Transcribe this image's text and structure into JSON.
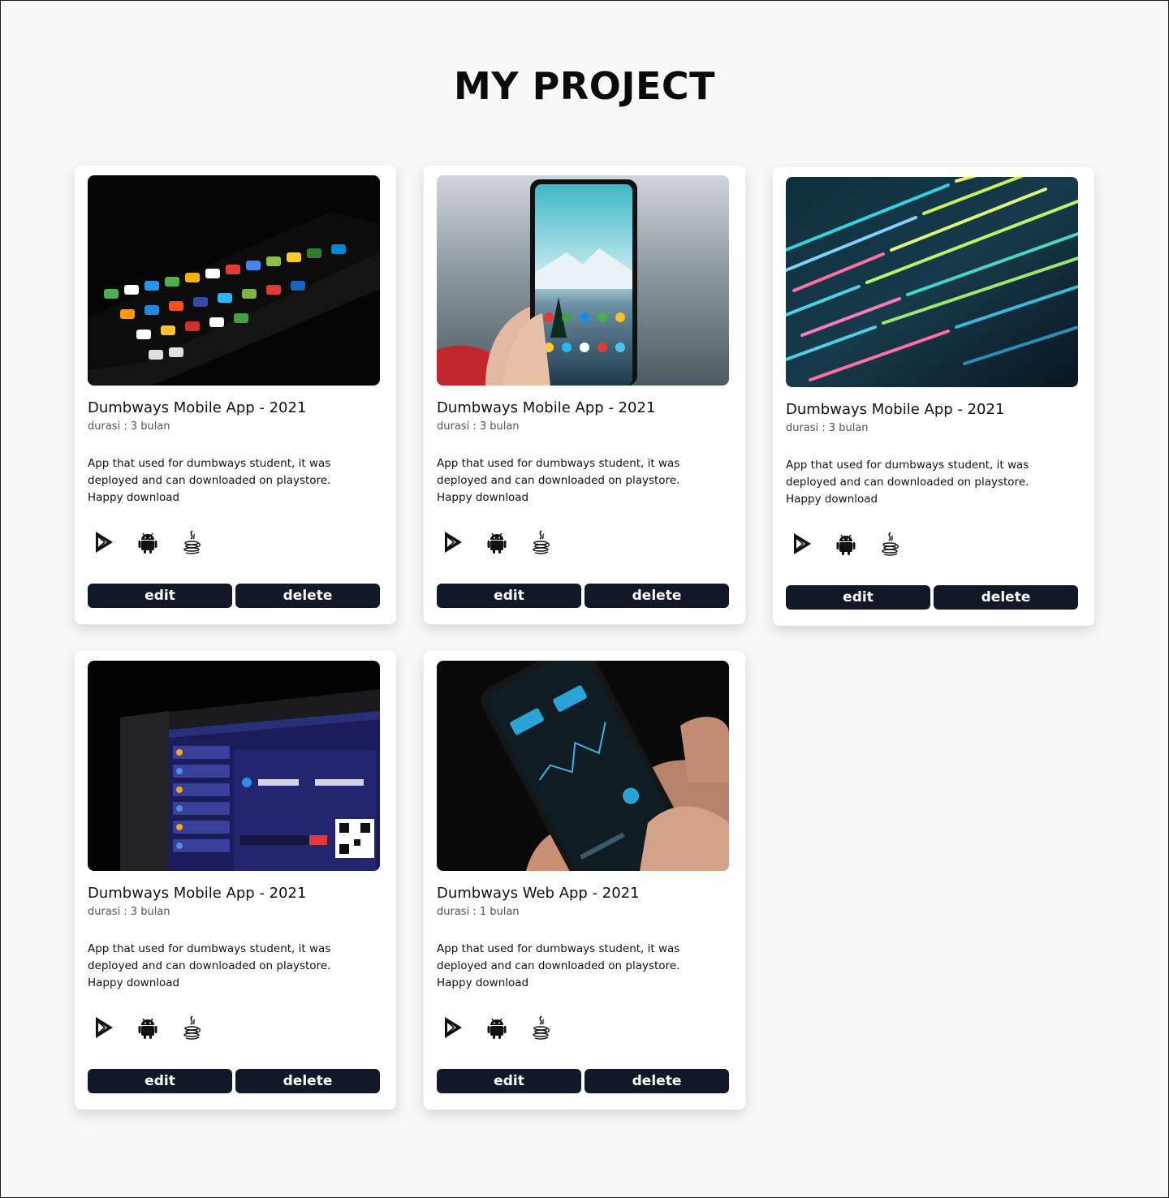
{
  "page": {
    "title": "MY PROJECT"
  },
  "projects": [
    {
      "title": "Dumbways Mobile App - 2021",
      "duration": "durasi : 3 bulan",
      "description": "App that used for dumbways student, it was deployed and can downloaded on playstore. Happy download",
      "image": "phone-app-icons-dark",
      "technologies": [
        "play-store-icon",
        "android-icon",
        "java-icon"
      ],
      "edit_label": "edit",
      "delete_label": "delete"
    },
    {
      "title": "Dumbways Mobile App - 2021",
      "duration": "durasi : 3 bulan",
      "description": "App that used for dumbways student, it was deployed and can downloaded on playstore. Happy download",
      "image": "hand-holding-phone",
      "technologies": [
        "play-store-icon",
        "android-icon",
        "java-icon"
      ],
      "edit_label": "edit",
      "delete_label": "delete"
    },
    {
      "title": "Dumbways Mobile App - 2021",
      "duration": "durasi : 3 bulan",
      "description": "App that used for dumbways student, it was deployed and can downloaded on playstore. Happy download",
      "image": "code-on-screen",
      "technologies": [
        "play-store-icon",
        "android-icon",
        "java-icon"
      ],
      "edit_label": "edit",
      "delete_label": "delete"
    },
    {
      "title": "Dumbways Mobile App - 2021",
      "duration": "durasi : 3 bulan",
      "description": "App that used for dumbways student, it was deployed and can downloaded on playstore. Happy download",
      "image": "crypto-dashboard-laptop",
      "technologies": [
        "play-store-icon",
        "android-icon",
        "java-icon"
      ],
      "edit_label": "edit",
      "delete_label": "delete"
    },
    {
      "title": "Dumbways Web App - 2021",
      "duration": "durasi : 1 bulan",
      "description": "App that used for dumbways student, it was deployed and can downloaded on playstore. Happy download",
      "image": "trading-app-phone",
      "technologies": [
        "play-store-icon",
        "android-icon",
        "java-icon"
      ],
      "edit_label": "edit",
      "delete_label": "delete"
    }
  ],
  "colors": {
    "button": "#111827",
    "background": "#f8f8f8",
    "card": "#ffffff"
  }
}
